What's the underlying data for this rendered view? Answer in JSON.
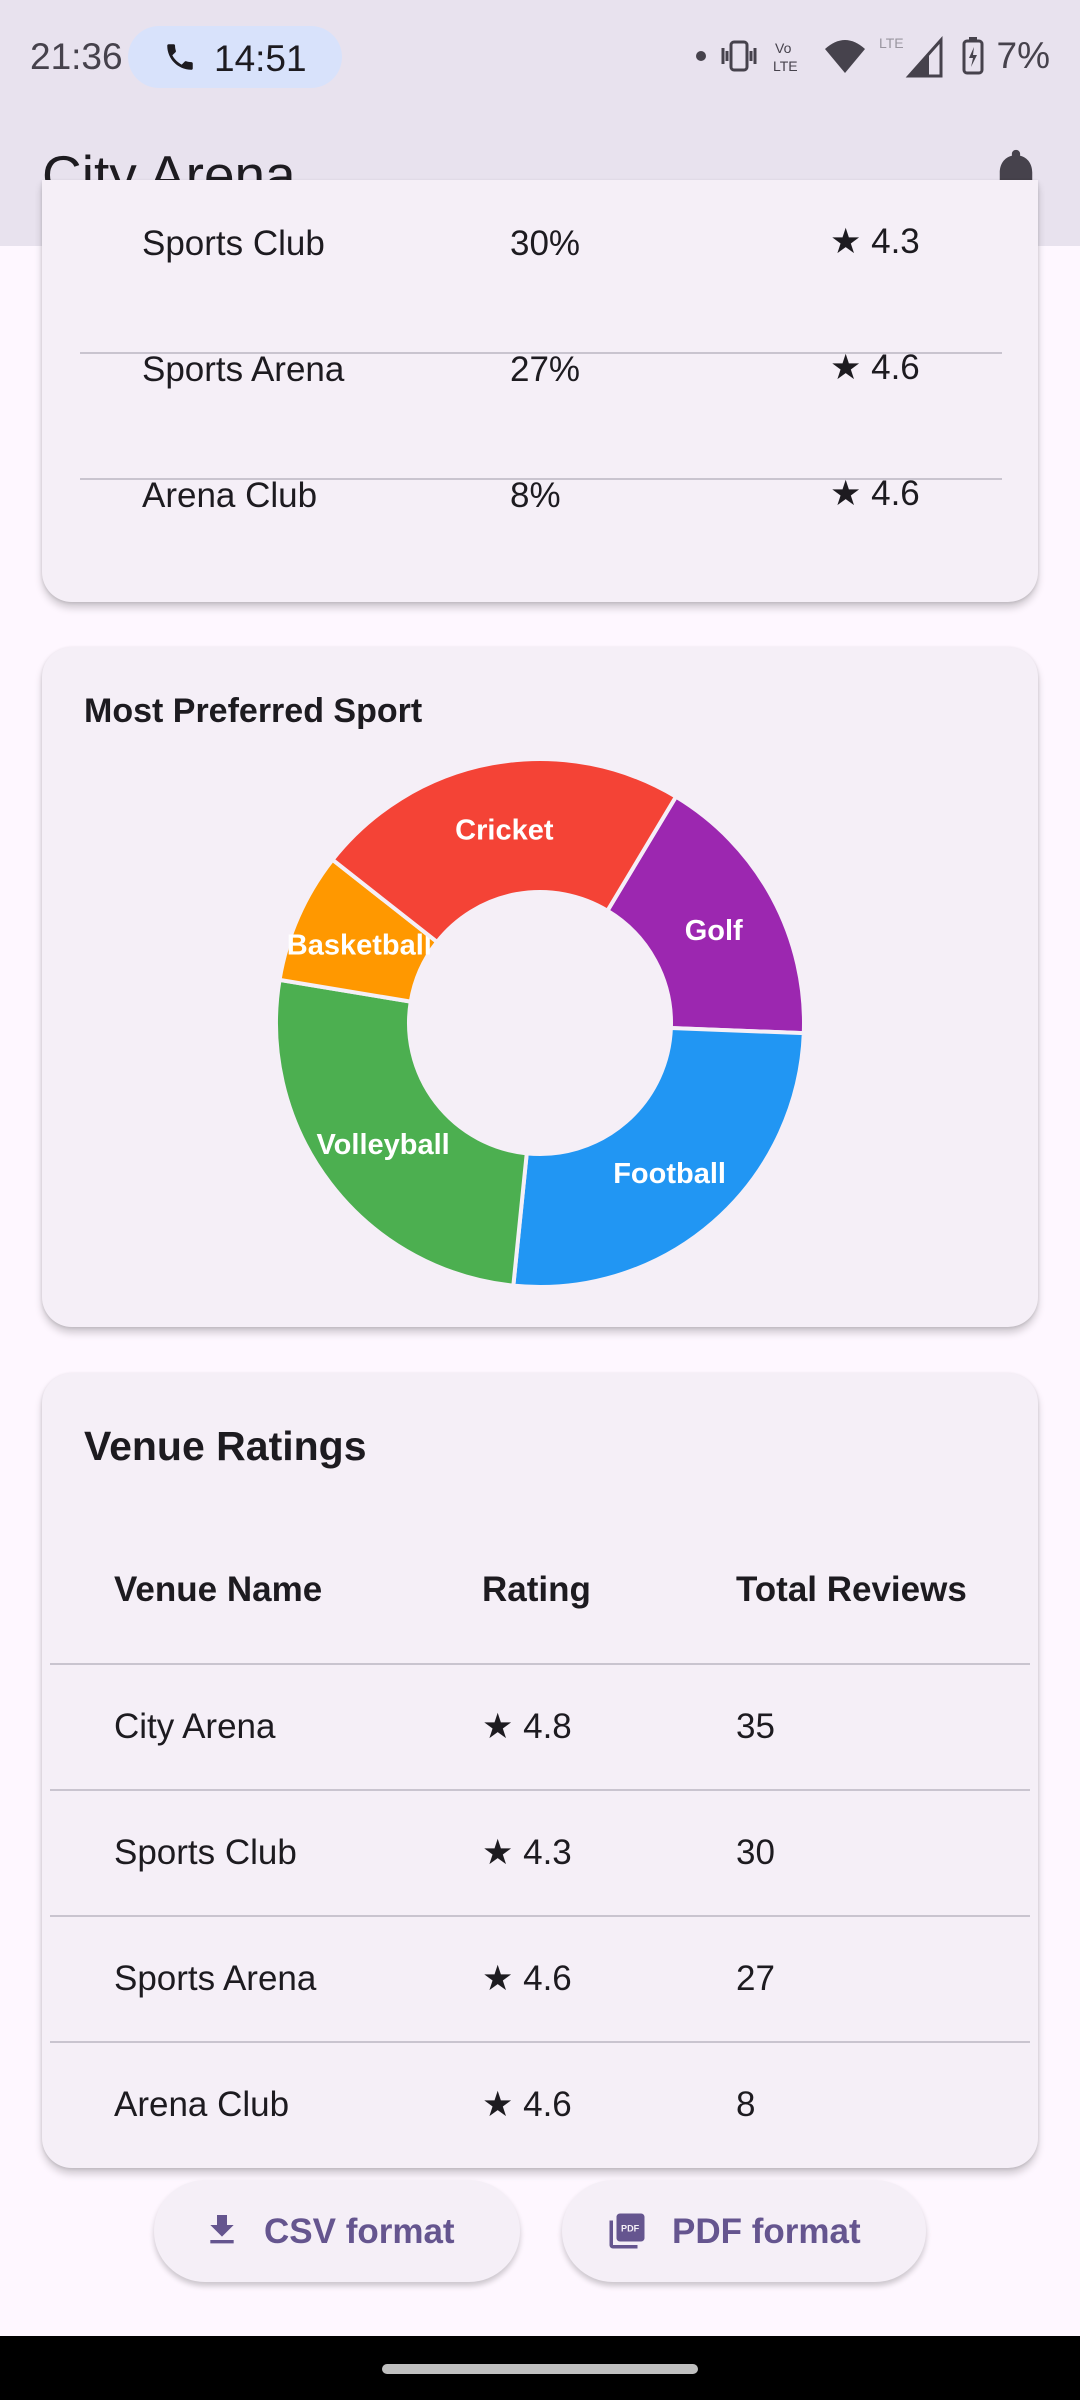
{
  "status_bar": {
    "time": "21:36",
    "call_time": "14:51",
    "battery": "7%",
    "icons": [
      "dot-icon",
      "vibrate-icon",
      "volte-icon",
      "wifi-icon",
      "lte-signal-icon",
      "battery-charging-icon"
    ]
  },
  "app_bar": {
    "title": "City Arena",
    "bell_icon": "bell-icon"
  },
  "top_table": {
    "rows": [
      {
        "name": "Sports Club",
        "share": "30%",
        "rating": "★ 4.3"
      },
      {
        "name": "Sports Arena",
        "share": "27%",
        "rating": "★ 4.6"
      },
      {
        "name": "Arena Club",
        "share": "8%",
        "rating": "★ 4.6"
      }
    ]
  },
  "preferred_sport": {
    "title": "Most Preferred Sport"
  },
  "chart_data": {
    "type": "pie",
    "title": "Most Preferred Sport",
    "donut": true,
    "slices": [
      {
        "label": "Golf",
        "value": 17,
        "color": "#9c27b0"
      },
      {
        "label": "Football",
        "value": 26,
        "color": "#2196f3"
      },
      {
        "label": "Volleyball",
        "value": 26,
        "color": "#4caf50"
      },
      {
        "label": "Basketball",
        "value": 8,
        "color": "#ff9800"
      },
      {
        "label": "Cricket",
        "value": 23,
        "color": "#f44336"
      }
    ]
  },
  "venue_ratings": {
    "title": "Venue Ratings",
    "headers": [
      "Venue Name",
      "Rating",
      "Total Reviews"
    ],
    "rows": [
      {
        "name": "City Arena",
        "rating": "★ 4.8",
        "reviews": "35"
      },
      {
        "name": "Sports Club",
        "rating": "★ 4.3",
        "reviews": "30"
      },
      {
        "name": "Sports Arena",
        "rating": "★ 4.6",
        "reviews": "27"
      },
      {
        "name": "Arena Club",
        "rating": "★ 4.6",
        "reviews": "8"
      }
    ]
  },
  "export": {
    "csv_label": "CSV format",
    "pdf_label": "PDF format",
    "csv_icon": "download-icon",
    "pdf_icon": "pdf-file-icon"
  },
  "colors": {
    "app_bar_bg": "#e8e2ee",
    "card_bg": "#f5eff7",
    "accent": "#65558f"
  }
}
